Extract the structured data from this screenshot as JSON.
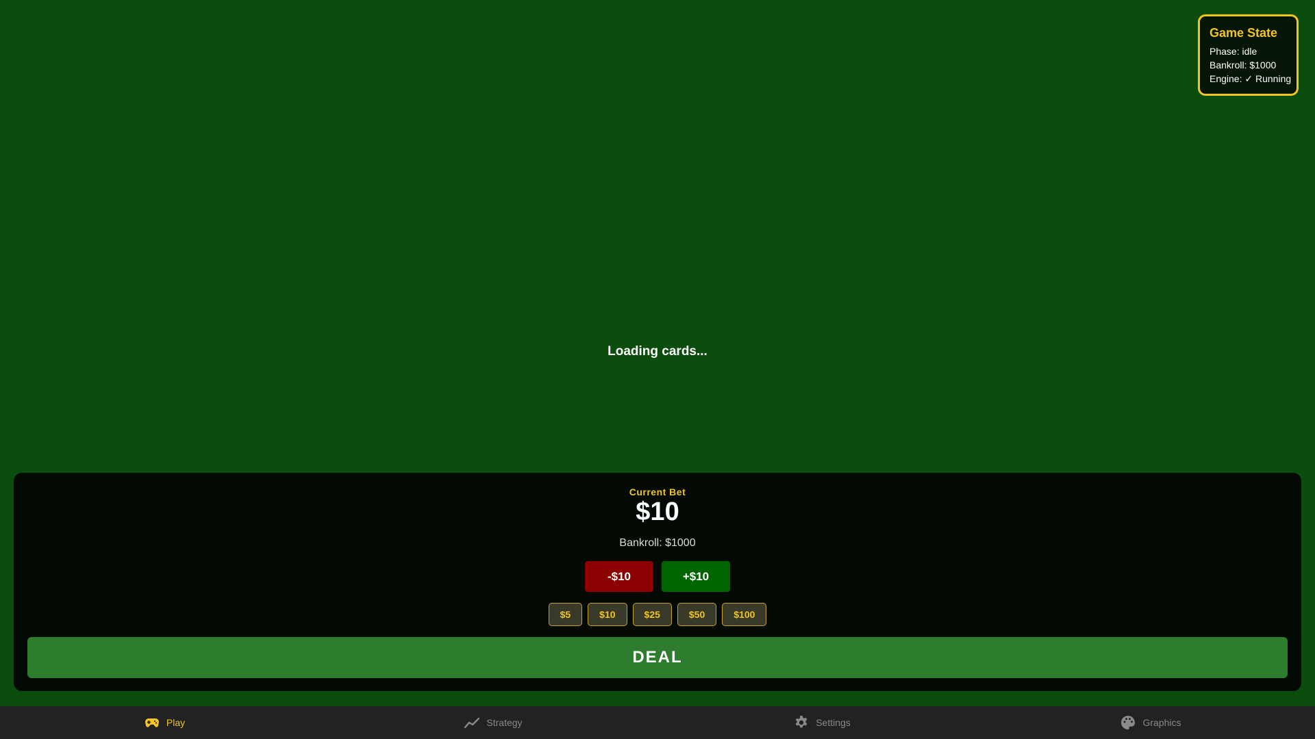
{
  "game_state": {
    "title": "Game State",
    "phase": "Phase: idle",
    "bankroll": "Bankroll: $1000",
    "engine": "Engine: ✓ Running"
  },
  "table": {
    "loading_text": "Loading cards..."
  },
  "bet": {
    "label": "Current Bet",
    "amount": "$10",
    "bankroll": "Bankroll: $1000",
    "decrease_label": "-$10",
    "increase_label": "+$10",
    "chips": [
      "$5",
      "$10",
      "$25",
      "$50",
      "$100"
    ],
    "deal_label": "DEAL"
  },
  "nav": {
    "items": [
      {
        "label": "Play",
        "icon": "gamepad-icon",
        "active": true
      },
      {
        "label": "Strategy",
        "icon": "trend-line-icon",
        "active": false
      },
      {
        "label": "Settings",
        "icon": "gear-icon",
        "active": false
      },
      {
        "label": "Graphics",
        "icon": "palette-icon",
        "active": false
      }
    ]
  },
  "colors": {
    "felt": "#0b4d0d",
    "accent": "#f2c521",
    "decrease": "#8b0000",
    "increase": "#006400",
    "deal": "#2e7d2e",
    "nav_bg": "#222222"
  }
}
